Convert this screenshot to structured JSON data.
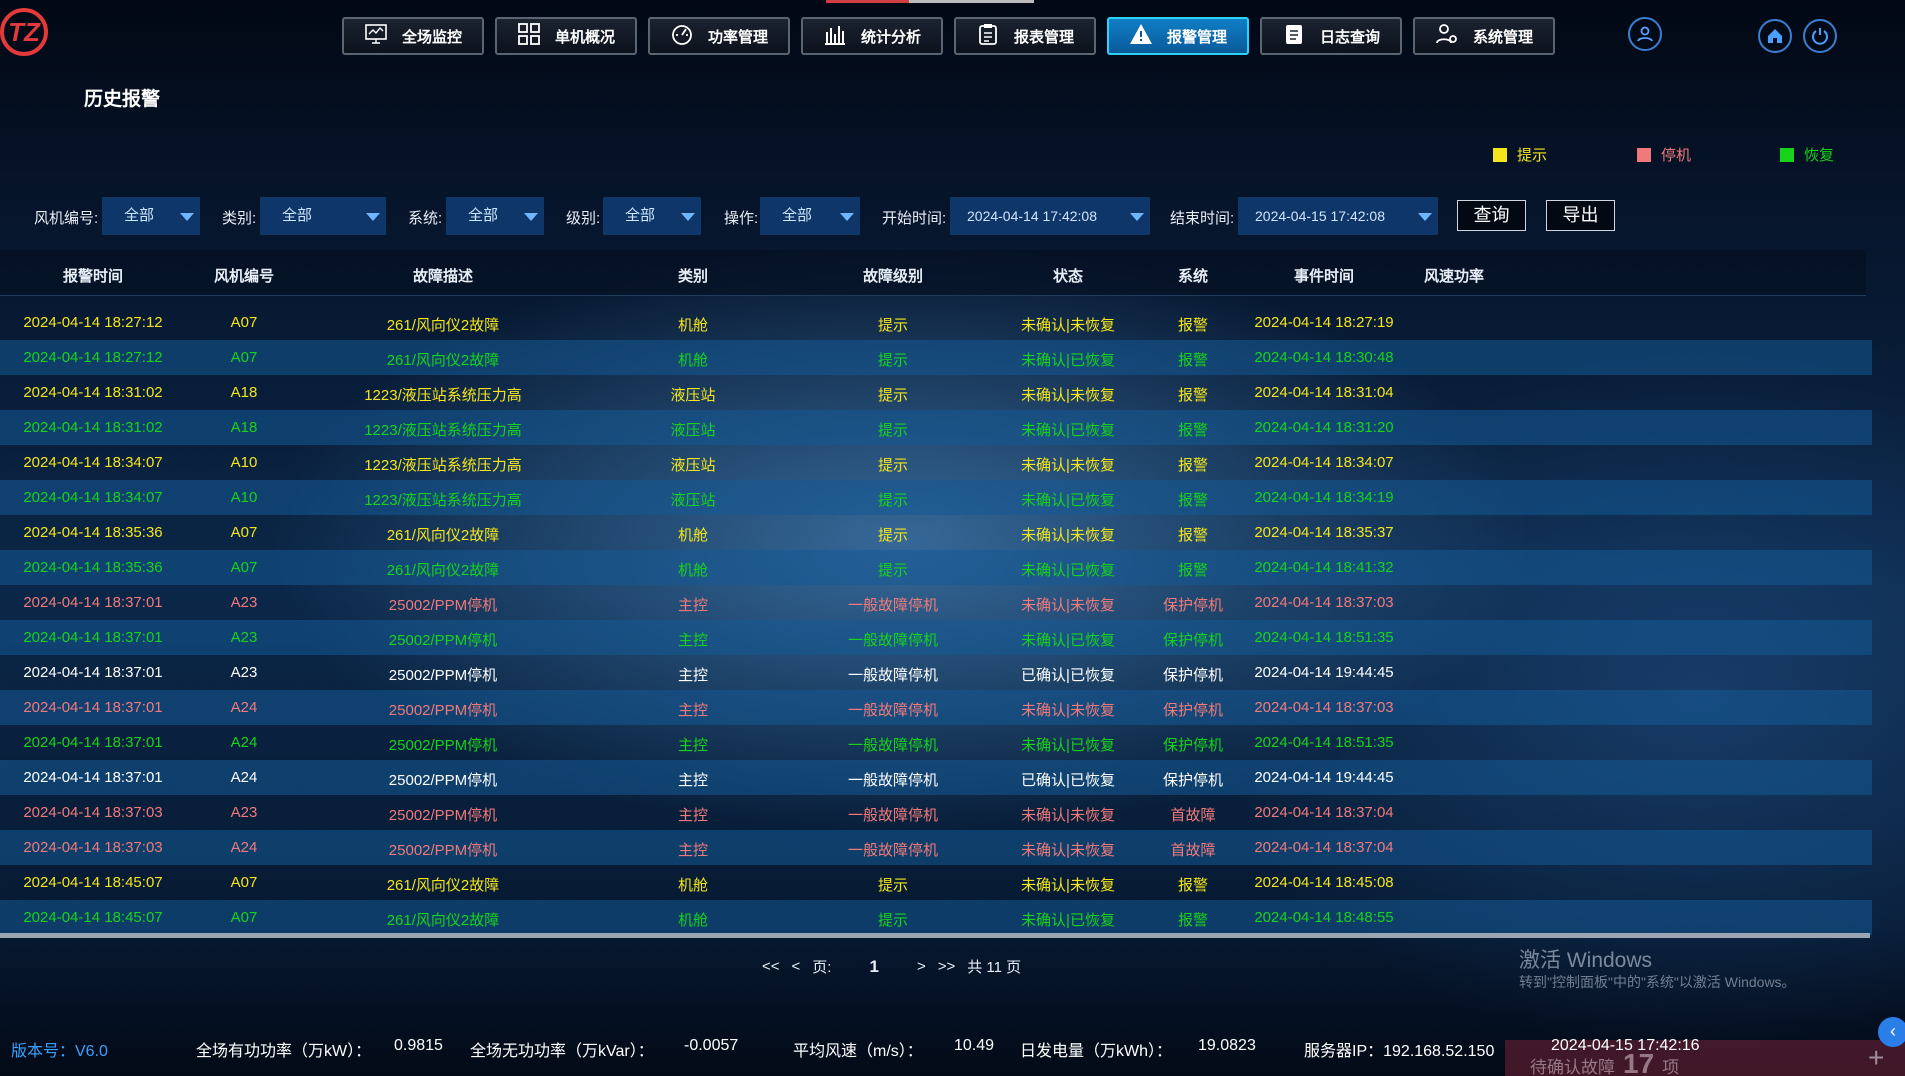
{
  "app": {
    "logo_text": "TZ",
    "page_title": "历史报警"
  },
  "nav": [
    {
      "label": "全场监控",
      "icon": "monitor-icon",
      "active": false
    },
    {
      "label": "单机概况",
      "icon": "grid-icon",
      "active": false
    },
    {
      "label": "功率管理",
      "icon": "gauge-icon",
      "active": false
    },
    {
      "label": "统计分析",
      "icon": "bar-chart-icon",
      "active": false
    },
    {
      "label": "报表管理",
      "icon": "clipboard-icon",
      "active": false
    },
    {
      "label": "报警管理",
      "icon": "warning-icon",
      "active": true
    },
    {
      "label": "日志查询",
      "icon": "notepad-icon",
      "active": false
    },
    {
      "label": "系统管理",
      "icon": "users-gear-icon",
      "active": false
    }
  ],
  "legend": [
    {
      "label": "提示",
      "color": "#f5e51b"
    },
    {
      "label": "停机",
      "color": "#f07a7a"
    },
    {
      "label": "恢复",
      "color": "#19d21b"
    }
  ],
  "filters": {
    "turbine_label": "风机编号:",
    "turbine_value": "全部",
    "category_label": "类别:",
    "category_value": "全部",
    "system_label": "系统:",
    "system_value": "全部",
    "level_label": "级别:",
    "level_value": "全部",
    "operation_label": "操作:",
    "operation_value": "全部",
    "start_label": "开始时间:",
    "start_value": "2024-04-14 17:42:08",
    "end_label": "结束时间:",
    "end_value": "2024-04-15 17:42:08",
    "query_button": "查询",
    "export_button": "导出"
  },
  "columns": [
    "报警时间",
    "风机编号",
    "故障描述",
    "类别",
    "故障级别",
    "状态",
    "系统",
    "事件时间",
    "风速功率"
  ],
  "rows": [
    [
      "2024-04-14 18:27:12",
      "A07",
      "261/风向仪2故障",
      "机舱",
      "提示",
      "未确认|未恢复",
      "报警",
      "2024-04-14 18:27:19",
      "yellow"
    ],
    [
      "2024-04-14 18:27:12",
      "A07",
      "261/风向仪2故障",
      "机舱",
      "提示",
      "未确认|已恢复",
      "报警",
      "2024-04-14 18:30:48",
      "green"
    ],
    [
      "2024-04-14 18:31:02",
      "A18",
      "1223/液压站系统压力高",
      "液压站",
      "提示",
      "未确认|未恢复",
      "报警",
      "2024-04-14 18:31:04",
      "yellow"
    ],
    [
      "2024-04-14 18:31:02",
      "A18",
      "1223/液压站系统压力高",
      "液压站",
      "提示",
      "未确认|已恢复",
      "报警",
      "2024-04-14 18:31:20",
      "green"
    ],
    [
      "2024-04-14 18:34:07",
      "A10",
      "1223/液压站系统压力高",
      "液压站",
      "提示",
      "未确认|未恢复",
      "报警",
      "2024-04-14 18:34:07",
      "yellow"
    ],
    [
      "2024-04-14 18:34:07",
      "A10",
      "1223/液压站系统压力高",
      "液压站",
      "提示",
      "未确认|已恢复",
      "报警",
      "2024-04-14 18:34:19",
      "green"
    ],
    [
      "2024-04-14 18:35:36",
      "A07",
      "261/风向仪2故障",
      "机舱",
      "提示",
      "未确认|未恢复",
      "报警",
      "2024-04-14 18:35:37",
      "yellow"
    ],
    [
      "2024-04-14 18:35:36",
      "A07",
      "261/风向仪2故障",
      "机舱",
      "提示",
      "未确认|已恢复",
      "报警",
      "2024-04-14 18:41:32",
      "green"
    ],
    [
      "2024-04-14 18:37:01",
      "A23",
      "25002/PPM停机",
      "主控",
      "一般故障停机",
      "未确认|未恢复",
      "保护停机",
      "2024-04-14 18:37:03",
      "red"
    ],
    [
      "2024-04-14 18:37:01",
      "A23",
      "25002/PPM停机",
      "主控",
      "一般故障停机",
      "未确认|已恢复",
      "保护停机",
      "2024-04-14 18:51:35",
      "green"
    ],
    [
      "2024-04-14 18:37:01",
      "A23",
      "25002/PPM停机",
      "主控",
      "一般故障停机",
      "已确认|已恢复",
      "保护停机",
      "2024-04-14 19:44:45",
      "white"
    ],
    [
      "2024-04-14 18:37:01",
      "A24",
      "25002/PPM停机",
      "主控",
      "一般故障停机",
      "未确认|未恢复",
      "保护停机",
      "2024-04-14 18:37:03",
      "red"
    ],
    [
      "2024-04-14 18:37:01",
      "A24",
      "25002/PPM停机",
      "主控",
      "一般故障停机",
      "未确认|已恢复",
      "保护停机",
      "2024-04-14 18:51:35",
      "green"
    ],
    [
      "2024-04-14 18:37:01",
      "A24",
      "25002/PPM停机",
      "主控",
      "一般故障停机",
      "已确认|已恢复",
      "保护停机",
      "2024-04-14 19:44:45",
      "white"
    ],
    [
      "2024-04-14 18:37:03",
      "A23",
      "25002/PPM停机",
      "主控",
      "一般故障停机",
      "未确认|未恢复",
      "首故障",
      "2024-04-14 18:37:04",
      "red"
    ],
    [
      "2024-04-14 18:37:03",
      "A24",
      "25002/PPM停机",
      "主控",
      "一般故障停机",
      "未确认|未恢复",
      "首故障",
      "2024-04-14 18:37:04",
      "red"
    ],
    [
      "2024-04-14 18:45:07",
      "A07",
      "261/风向仪2故障",
      "机舱",
      "提示",
      "未确认|未恢复",
      "报警",
      "2024-04-14 18:45:08",
      "yellow"
    ],
    [
      "2024-04-14 18:45:07",
      "A07",
      "261/风向仪2故障",
      "机舱",
      "提示",
      "未确认|已恢复",
      "报警",
      "2024-04-14 18:48:55",
      "green"
    ]
  ],
  "row_colors": {
    "yellow": "#f5e51b",
    "green": "#19d21b",
    "red": "#f07a7a",
    "white": "#ffffff"
  },
  "pager": {
    "first": "<<",
    "prev": "<",
    "page_label": "页:",
    "current": "1",
    "next": ">",
    "last": ">>",
    "total": "共 11 页"
  },
  "footer": {
    "version": "版本号：V6.0",
    "active_power_label": "全场有功功率（万kW）：",
    "active_power": "0.9815",
    "reactive_power_label": "全场无功功率（万kVar）：",
    "reactive_power": "-0.0057",
    "wind_label": "平均风速（m/s）：",
    "wind": "10.49",
    "energy_label": "日发电量（万kWh）：",
    "energy": "19.0823",
    "server": "服务器IP：192.168.52.150",
    "datetime": "2024-04-15 17:42:16"
  },
  "pending": {
    "label": "待确认故障",
    "count": "17",
    "unit": "项"
  },
  "watermark": {
    "line1": "激活 Windows",
    "line2": "转到\"控制面板\"中的\"系统\"以激活 Windows。"
  }
}
